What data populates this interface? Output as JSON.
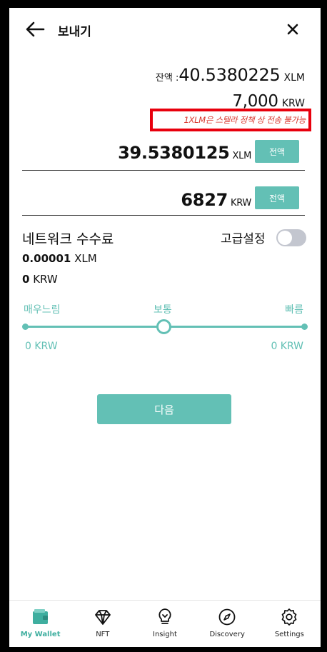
{
  "header": {
    "title": "보내기",
    "back_icon": "arrow-left-icon",
    "close_icon": "close-icon"
  },
  "balance": {
    "label": "잔액 :",
    "value": "40.5380225",
    "unit": "XLM"
  },
  "balance_krw": {
    "value": "7,000",
    "unit": "KRW"
  },
  "warning": {
    "text": "1XLM은 스텔라 정책 상 전송 불가능",
    "color": "#d9342b"
  },
  "amount_xlm": {
    "value": "39.5380125",
    "unit": "XLM",
    "max_label": "전액"
  },
  "amount_krw": {
    "value": "6827",
    "unit": "KRW",
    "max_label": "전액"
  },
  "network_fee": {
    "title": "네트워크 수수료",
    "advanced_label": "고급설정",
    "advanced_enabled": false,
    "xlm_value": "0.00001",
    "xlm_unit": "XLM",
    "krw_value": "0",
    "krw_unit": "KRW"
  },
  "speed": {
    "slow": "매우느림",
    "normal": "보통",
    "fast": "빠름",
    "selected": "보통",
    "low_fee": "0 KRW",
    "high_fee": "0 KRW"
  },
  "next_button": "다음",
  "accent_color": "#63c0b5",
  "nav": [
    {
      "label": "My Wallet",
      "icon": "wallet-icon",
      "active": true
    },
    {
      "label": "NFT",
      "icon": "diamond-icon",
      "active": false
    },
    {
      "label": "Insight",
      "icon": "lightbulb-icon",
      "active": false
    },
    {
      "label": "Discovery",
      "icon": "compass-icon",
      "active": false
    },
    {
      "label": "Settings",
      "icon": "gear-icon",
      "active": false
    }
  ]
}
